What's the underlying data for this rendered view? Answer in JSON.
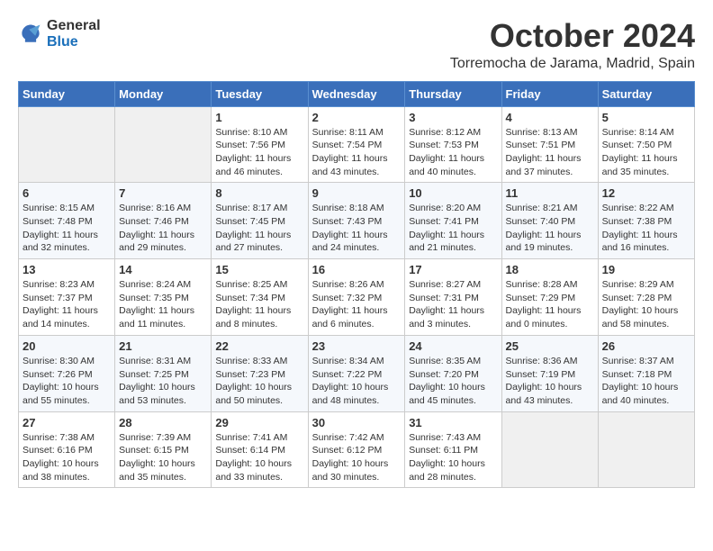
{
  "header": {
    "logo_general": "General",
    "logo_blue": "Blue",
    "month_title": "October 2024",
    "location": "Torremocha de Jarama, Madrid, Spain"
  },
  "days_of_week": [
    "Sunday",
    "Monday",
    "Tuesday",
    "Wednesday",
    "Thursday",
    "Friday",
    "Saturday"
  ],
  "weeks": [
    [
      {
        "day": "",
        "info": ""
      },
      {
        "day": "",
        "info": ""
      },
      {
        "day": "1",
        "info": "Sunrise: 8:10 AM\nSunset: 7:56 PM\nDaylight: 11 hours and 46 minutes."
      },
      {
        "day": "2",
        "info": "Sunrise: 8:11 AM\nSunset: 7:54 PM\nDaylight: 11 hours and 43 minutes."
      },
      {
        "day": "3",
        "info": "Sunrise: 8:12 AM\nSunset: 7:53 PM\nDaylight: 11 hours and 40 minutes."
      },
      {
        "day": "4",
        "info": "Sunrise: 8:13 AM\nSunset: 7:51 PM\nDaylight: 11 hours and 37 minutes."
      },
      {
        "day": "5",
        "info": "Sunrise: 8:14 AM\nSunset: 7:50 PM\nDaylight: 11 hours and 35 minutes."
      }
    ],
    [
      {
        "day": "6",
        "info": "Sunrise: 8:15 AM\nSunset: 7:48 PM\nDaylight: 11 hours and 32 minutes."
      },
      {
        "day": "7",
        "info": "Sunrise: 8:16 AM\nSunset: 7:46 PM\nDaylight: 11 hours and 29 minutes."
      },
      {
        "day": "8",
        "info": "Sunrise: 8:17 AM\nSunset: 7:45 PM\nDaylight: 11 hours and 27 minutes."
      },
      {
        "day": "9",
        "info": "Sunrise: 8:18 AM\nSunset: 7:43 PM\nDaylight: 11 hours and 24 minutes."
      },
      {
        "day": "10",
        "info": "Sunrise: 8:20 AM\nSunset: 7:41 PM\nDaylight: 11 hours and 21 minutes."
      },
      {
        "day": "11",
        "info": "Sunrise: 8:21 AM\nSunset: 7:40 PM\nDaylight: 11 hours and 19 minutes."
      },
      {
        "day": "12",
        "info": "Sunrise: 8:22 AM\nSunset: 7:38 PM\nDaylight: 11 hours and 16 minutes."
      }
    ],
    [
      {
        "day": "13",
        "info": "Sunrise: 8:23 AM\nSunset: 7:37 PM\nDaylight: 11 hours and 14 minutes."
      },
      {
        "day": "14",
        "info": "Sunrise: 8:24 AM\nSunset: 7:35 PM\nDaylight: 11 hours and 11 minutes."
      },
      {
        "day": "15",
        "info": "Sunrise: 8:25 AM\nSunset: 7:34 PM\nDaylight: 11 hours and 8 minutes."
      },
      {
        "day": "16",
        "info": "Sunrise: 8:26 AM\nSunset: 7:32 PM\nDaylight: 11 hours and 6 minutes."
      },
      {
        "day": "17",
        "info": "Sunrise: 8:27 AM\nSunset: 7:31 PM\nDaylight: 11 hours and 3 minutes."
      },
      {
        "day": "18",
        "info": "Sunrise: 8:28 AM\nSunset: 7:29 PM\nDaylight: 11 hours and 0 minutes."
      },
      {
        "day": "19",
        "info": "Sunrise: 8:29 AM\nSunset: 7:28 PM\nDaylight: 10 hours and 58 minutes."
      }
    ],
    [
      {
        "day": "20",
        "info": "Sunrise: 8:30 AM\nSunset: 7:26 PM\nDaylight: 10 hours and 55 minutes."
      },
      {
        "day": "21",
        "info": "Sunrise: 8:31 AM\nSunset: 7:25 PM\nDaylight: 10 hours and 53 minutes."
      },
      {
        "day": "22",
        "info": "Sunrise: 8:33 AM\nSunset: 7:23 PM\nDaylight: 10 hours and 50 minutes."
      },
      {
        "day": "23",
        "info": "Sunrise: 8:34 AM\nSunset: 7:22 PM\nDaylight: 10 hours and 48 minutes."
      },
      {
        "day": "24",
        "info": "Sunrise: 8:35 AM\nSunset: 7:20 PM\nDaylight: 10 hours and 45 minutes."
      },
      {
        "day": "25",
        "info": "Sunrise: 8:36 AM\nSunset: 7:19 PM\nDaylight: 10 hours and 43 minutes."
      },
      {
        "day": "26",
        "info": "Sunrise: 8:37 AM\nSunset: 7:18 PM\nDaylight: 10 hours and 40 minutes."
      }
    ],
    [
      {
        "day": "27",
        "info": "Sunrise: 7:38 AM\nSunset: 6:16 PM\nDaylight: 10 hours and 38 minutes."
      },
      {
        "day": "28",
        "info": "Sunrise: 7:39 AM\nSunset: 6:15 PM\nDaylight: 10 hours and 35 minutes."
      },
      {
        "day": "29",
        "info": "Sunrise: 7:41 AM\nSunset: 6:14 PM\nDaylight: 10 hours and 33 minutes."
      },
      {
        "day": "30",
        "info": "Sunrise: 7:42 AM\nSunset: 6:12 PM\nDaylight: 10 hours and 30 minutes."
      },
      {
        "day": "31",
        "info": "Sunrise: 7:43 AM\nSunset: 6:11 PM\nDaylight: 10 hours and 28 minutes."
      },
      {
        "day": "",
        "info": ""
      },
      {
        "day": "",
        "info": ""
      }
    ]
  ]
}
